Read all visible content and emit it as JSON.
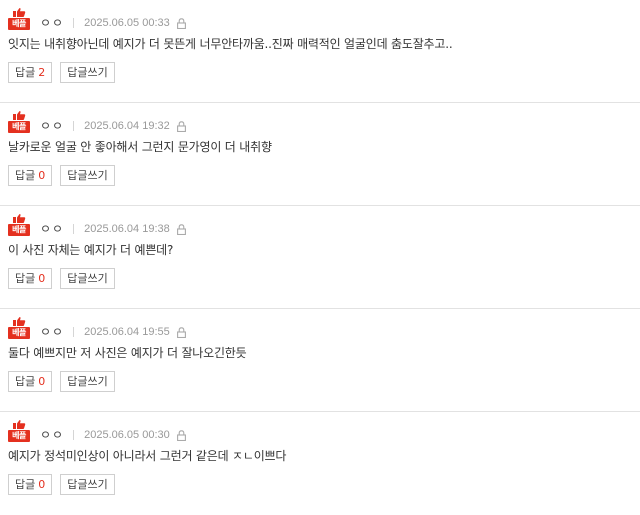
{
  "badge_label": "베플",
  "reply_label": "답글",
  "write_reply_label": "답글쓰기",
  "accent_color": "#e4301f",
  "comments": [
    {
      "nickname": "ㅇㅇ",
      "date": "2025.06.05 00:33",
      "text": "잇지는 내취향아닌데 예지가 더 못뜬게 너무안타까움..진짜 매력적인 얼굴인데 춤도잘추고..",
      "reply_count": "2"
    },
    {
      "nickname": "ㅇㅇ",
      "date": "2025.06.04 19:32",
      "text": "날카로운 얼굴 안 좋아해서 그런지 문가영이 더 내취향",
      "reply_count": "0"
    },
    {
      "nickname": "ㅇㅇ",
      "date": "2025.06.04 19:38",
      "text": "이 사진 자체는 예지가 더 예쁜데?",
      "reply_count": "0"
    },
    {
      "nickname": "ㅇㅇ",
      "date": "2025.06.04 19:55",
      "text": "둘다 예쁘지만 저 사진은 예지가 더 잘나오긴한듯",
      "reply_count": "0"
    },
    {
      "nickname": "ㅇㅇ",
      "date": "2025.06.05 00:30",
      "text": "예지가 정석미인상이 아니라서 그런거 같은데 ㅈㄴ이쁘다",
      "reply_count": "0"
    }
  ]
}
